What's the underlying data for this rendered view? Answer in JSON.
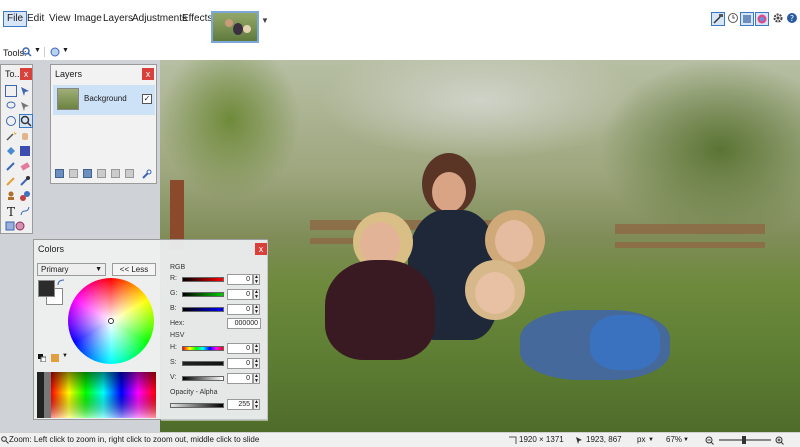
{
  "menu": {
    "file": "File",
    "edit": "Edit",
    "view": "View",
    "image": "Image",
    "layers": "Layers",
    "adjustments": "Adjustments",
    "effects": "Effects"
  },
  "toolbar": {
    "tools_label": "Tools:"
  },
  "tools_window": {
    "title": "To...",
    "close": "x"
  },
  "layers_window": {
    "title": "Layers",
    "close": "x",
    "layer_name": "Background",
    "layer_visible": "✓"
  },
  "colors_window": {
    "title": "Colors",
    "close": "x",
    "mode": "Primary",
    "less_button": "<< Less",
    "rgb_label": "RGB",
    "r_label": "R:",
    "g_label": "G:",
    "b_label": "B:",
    "r_value": "0",
    "g_value": "0",
    "b_value": "0",
    "hex_label": "Hex:",
    "hex_value": "000000",
    "hsv_label": "HSV",
    "h_label": "H:",
    "s_label": "S:",
    "v_label": "V:",
    "h_value": "0",
    "s_value": "0",
    "v_value": "0",
    "opacity_label": "Opacity - Alpha",
    "alpha_value": "255"
  },
  "status": {
    "hint": "Zoom: Left click to zoom in, right click to zoom out, middle click to slide",
    "image_size": "1920 × 1371",
    "cursor_pos": "1923, 867",
    "unit": "px",
    "zoom": "67%"
  },
  "colors": {
    "accent": "#3b79c4",
    "close": "#d9403a",
    "selected_layer": "#cde1f7"
  }
}
